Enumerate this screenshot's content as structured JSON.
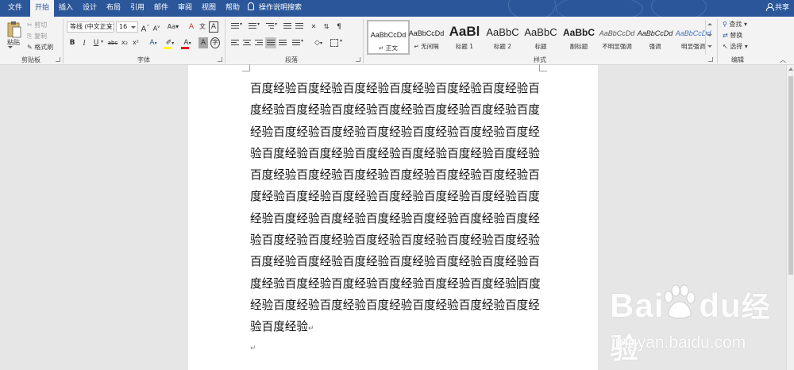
{
  "tabs": [
    {
      "label": "文件",
      "active": false
    },
    {
      "label": "开始",
      "active": true
    },
    {
      "label": "插入",
      "active": false
    },
    {
      "label": "设计",
      "active": false
    },
    {
      "label": "布局",
      "active": false
    },
    {
      "label": "引用",
      "active": false
    },
    {
      "label": "邮件",
      "active": false
    },
    {
      "label": "审阅",
      "active": false
    },
    {
      "label": "视图",
      "active": false
    },
    {
      "label": "帮助",
      "active": false
    }
  ],
  "search_label": "操作说明搜索",
  "share_label": "共享",
  "clipboard": {
    "paste": "粘贴",
    "cut": "剪切",
    "copy": "复制",
    "format_painter": "格式刷",
    "group_label": "剪贴板"
  },
  "font": {
    "family": "等线 (中文正文)",
    "size": "16",
    "bold": "B",
    "italic": "I",
    "underline": "U",
    "strike": "abc",
    "subscript": "x₂",
    "superscript": "x²",
    "grow": "A",
    "shrink": "A",
    "case": "Aa",
    "clear": "A",
    "color_a": "A",
    "char_a": "A",
    "group_label": "字体"
  },
  "paragraph": {
    "show_marks": "¶",
    "group_label": "段落"
  },
  "styles": {
    "items": [
      {
        "preview": "AaBbCcDd",
        "name": "↵ 正文",
        "selected": true
      },
      {
        "preview": "AaBbCcDd",
        "name": "↵ 无间隔",
        "selected": false
      },
      {
        "preview": "AaBl",
        "name": "标题 1",
        "selected": false
      },
      {
        "preview": "AaBbC",
        "name": "标题 2",
        "selected": false
      },
      {
        "preview": "AaBbC",
        "name": "标题",
        "selected": false
      },
      {
        "preview": "AaBbC",
        "name": "副标题",
        "selected": false
      },
      {
        "preview": "AaBbCcDd",
        "name": "不明显强调",
        "selected": false
      },
      {
        "preview": "AaBbCcDd",
        "name": "强调",
        "selected": false
      },
      {
        "preview": "AaBbCcDd",
        "name": "明显强调",
        "selected": false
      }
    ],
    "group_label": "样式"
  },
  "editing": {
    "find": "查找",
    "replace": "替换",
    "select": "选择",
    "group_label": "编辑"
  },
  "document": {
    "lines": [
      "百度经验百度经验百度经验百度经验百度经验百度经验百",
      "度经验百度经验百度经验百度经验百度经验百度经验百度",
      "经验百度经验百度经验百度经验百度经验百度经验百度经",
      "验百度经验百度经验百度经验百度经验百度经验百度经验",
      "百度经验百度经验百度经验百度经验百度经验百度经验百",
      "度经验百度经验百度经验百度经验百度经验百度经验百度",
      "经验百度经验百度经验百度经验百度经验百度经验百度经",
      "验百度经验百度经验百度经验百度经验百度经验百度经验",
      "百度经验百度经验百度经验百度经验百度经验百度经验百",
      "度经验百度经验百度经验百度经验百度经验百度经验",
      "百度",
      "经验百度经验百度经验百度经验百度经验百度经验百度经",
      "验百度经验"
    ],
    "paragraph_mark": "↵",
    "empty_paragraph_mark": "↵"
  },
  "watermark": {
    "logo_left": "Bai",
    "logo_right": "du",
    "logo_cn": "经验",
    "url": "jingyan.baidu.com"
  },
  "colors": {
    "titlebar": "#2b579a",
    "ribbon": "#f3f3f3",
    "canvas": "#e6e6e6",
    "page": "#ffffff",
    "font_color_bar": "#e81123",
    "highlight_bar": "#ffff00"
  }
}
